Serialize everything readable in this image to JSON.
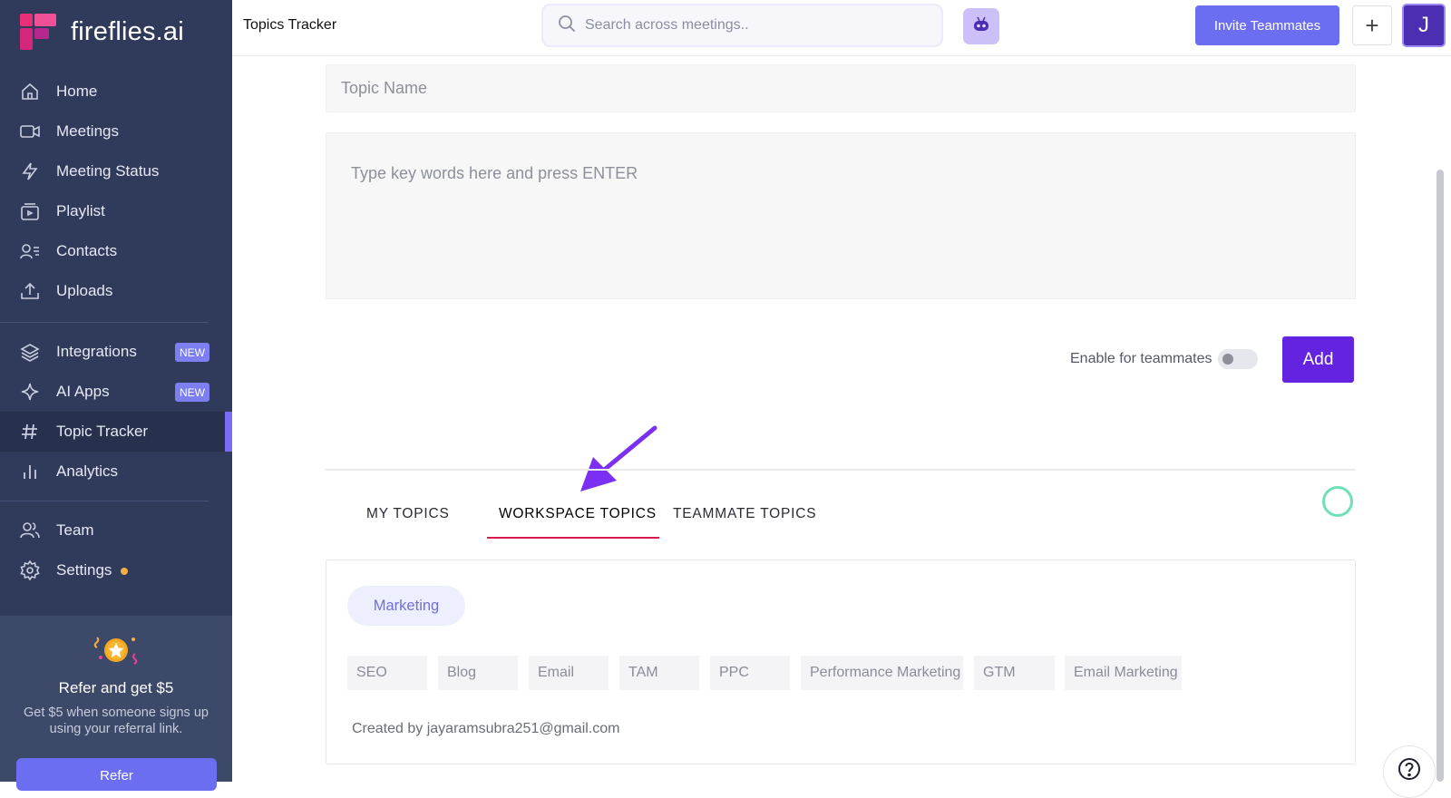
{
  "brand": {
    "name": "fireflies.ai"
  },
  "sidebar": {
    "main_items": [
      {
        "label": "Home",
        "icon": "home-icon"
      },
      {
        "label": "Meetings",
        "icon": "video-icon"
      },
      {
        "label": "Meeting Status",
        "icon": "lightning-icon"
      },
      {
        "label": "Playlist",
        "icon": "playlist-icon"
      },
      {
        "label": "Contacts",
        "icon": "contacts-icon"
      },
      {
        "label": "Uploads",
        "icon": "upload-icon"
      }
    ],
    "secondary_items": [
      {
        "label": "Integrations",
        "icon": "layers-icon",
        "badge": "NEW"
      },
      {
        "label": "AI Apps",
        "icon": "sparkle-icon",
        "badge": "NEW"
      },
      {
        "label": "Topic Tracker",
        "icon": "hash-icon",
        "active": true
      },
      {
        "label": "Analytics",
        "icon": "bar-chart-icon"
      }
    ],
    "bottom_items": [
      {
        "label": "Team",
        "icon": "team-icon"
      },
      {
        "label": "Settings",
        "icon": "gear-icon",
        "notification_dot": true
      }
    ],
    "refer": {
      "title": "Refer and get $5",
      "subtitle": "Get $5 when someone signs up using your referral link.",
      "button": "Refer"
    }
  },
  "header": {
    "title": "Topics Tracker",
    "search_placeholder": "Search across meetings..",
    "invite_label": "Invite Teammates",
    "plus_label": "+",
    "avatar_initial": "J"
  },
  "form": {
    "topic_name_placeholder": "Topic Name",
    "keywords_placeholder": "Type key words here and press ENTER",
    "enable_label": "Enable for teammates",
    "enable_value": false,
    "add_label": "Add"
  },
  "tabs": [
    {
      "label": "MY TOPICS"
    },
    {
      "label": "WORKSPACE TOPICS",
      "active": true
    },
    {
      "label": "TEAMMATE TOPICS"
    }
  ],
  "topic_card": {
    "category": "Marketing",
    "keywords": [
      "SEO",
      "Blog",
      "Email",
      "TAM",
      "PPC",
      "Performance Marketing",
      "GTM",
      "Email Marketing"
    ],
    "created_by": "Created by jayaramsubra251@gmail.com"
  },
  "colors": {
    "sidebar_bg": "#303b5c",
    "accent": "#6c6ef2",
    "add_button": "#6323e0",
    "active_tab_underline": "#d81b4c",
    "annotation_arrow": "#7b2ff2"
  }
}
